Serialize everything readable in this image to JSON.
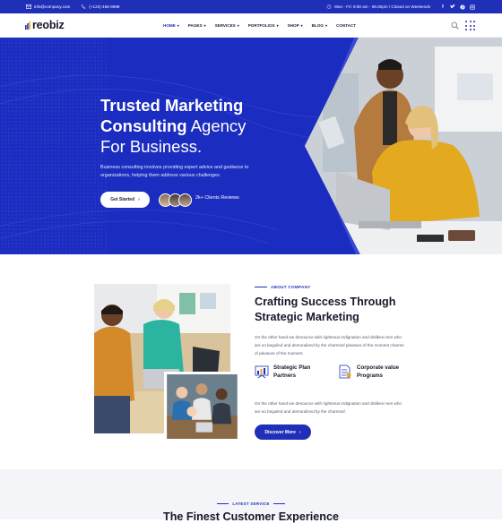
{
  "topbar": {
    "email": "info@company.com",
    "phone": "(+123) 456-9989",
    "hours": "Mon - Fri: 9:00 am - 06.00pm / Closed on Weekends",
    "social": [
      "facebook-icon",
      "twitter-icon",
      "pinterest-icon",
      "instagram-icon"
    ]
  },
  "header": {
    "logo": "reobiz",
    "nav": [
      {
        "label": "HOME",
        "has_dropdown": true,
        "active": true
      },
      {
        "label": "PAGES",
        "has_dropdown": true
      },
      {
        "label": "SERVICES",
        "has_dropdown": true
      },
      {
        "label": "PORTFOLIOS",
        "has_dropdown": true
      },
      {
        "label": "SHOP",
        "has_dropdown": true
      },
      {
        "label": "BLOG",
        "has_dropdown": true
      },
      {
        "label": "CONTACT",
        "has_dropdown": false
      }
    ]
  },
  "hero": {
    "title_bold_1": "Trusted Marketing",
    "title_bold_2": "Consulting",
    "title_light_2": " Agency",
    "title_light_3": "For Business.",
    "description": "Business consulting involves providing expert advice and guidance to organizations, helping them address various challenges.",
    "cta_label": "Get Started",
    "reviews": "2k+ Clients Reviews"
  },
  "about": {
    "tag": "ABOUT COMPANY",
    "title": "Crafting Success Through Strategic Marketing",
    "paragraph_1": "On the other hand we denounce with righteous indignation and dislikes men who are so beguiled and demoralized by the charmsof pleasure of the moment charms of pleasure of the moment.",
    "features": [
      {
        "label": "Strategic Plan Partners",
        "icon": "chart-icon"
      },
      {
        "label": "Corporate value Programs",
        "icon": "document-icon"
      }
    ],
    "paragraph_2": "On the other hand we denounce with righteous indignation and dislikes men who are so beguiled and demoralized by the charmsof.",
    "cta_label": "Discover More"
  },
  "services": {
    "tag": "LATEST SERVICE",
    "title": "The Finest Customer Experience"
  },
  "colors": {
    "primary": "#1f2fb8",
    "dark": "#17182b",
    "accent_yellow": "#e3a91f"
  }
}
